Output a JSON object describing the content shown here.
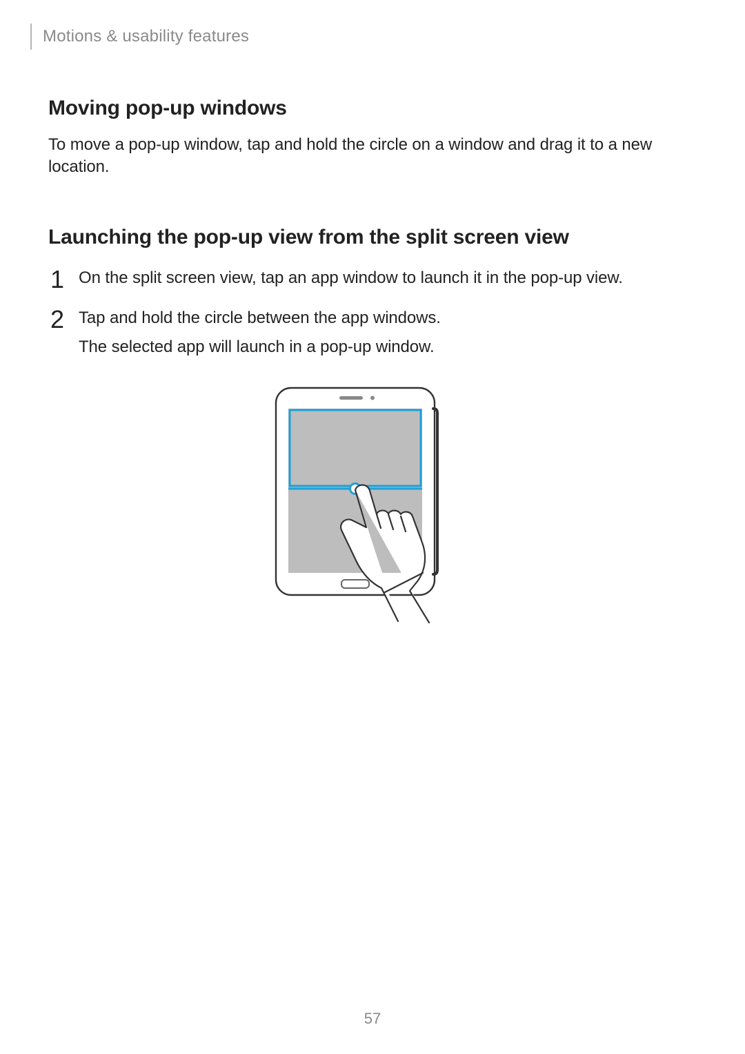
{
  "breadcrumb": "Motions & usability features",
  "section1": {
    "heading": "Moving pop-up windows",
    "paragraph": "To move a pop-up window, tap and hold the circle on a window and drag it to a new location."
  },
  "section2": {
    "heading": "Launching the pop-up view from the split screen view",
    "steps": [
      {
        "n": "1",
        "lines": [
          "On the split screen view, tap an app window to launch it in the pop-up view."
        ]
      },
      {
        "n": "2",
        "lines": [
          "Tap and hold the circle between the app windows.",
          "The selected app will launch in a pop-up window."
        ]
      }
    ]
  },
  "pageNumber": "57"
}
